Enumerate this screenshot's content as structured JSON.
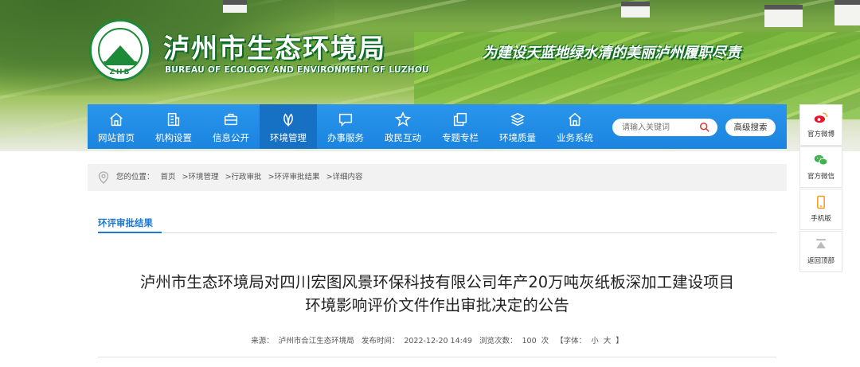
{
  "header": {
    "title": "泸州市生态环境局",
    "subtitle": "BUREAU OF ECOLOGY AND ENVIRONMENT OF LUZHOU",
    "slogan": "为建设天蓝地绿水清的美丽泸州履职尽责",
    "logo_text": "ZHB"
  },
  "nav": {
    "items": [
      {
        "label": "网站首页",
        "icon": "home-icon"
      },
      {
        "label": "机构设置",
        "icon": "building-icon"
      },
      {
        "label": "信息公开",
        "icon": "briefcase-icon"
      },
      {
        "label": "环境管理",
        "icon": "leaf-icon"
      },
      {
        "label": "办事服务",
        "icon": "message-icon"
      },
      {
        "label": "政民互动",
        "icon": "star-icon"
      },
      {
        "label": "专题专栏",
        "icon": "copy-icon"
      },
      {
        "label": "环境质量",
        "icon": "layers-icon"
      },
      {
        "label": "业务系统",
        "icon": "home-icon"
      }
    ],
    "active_index": 3,
    "search_placeholder": "请输入关键词",
    "advanced_search": "高级搜索"
  },
  "sidebar": {
    "items": [
      {
        "label": "官方微博",
        "icon": "weibo-icon"
      },
      {
        "label": "官方微信",
        "icon": "wechat-icon"
      },
      {
        "label": "手机版",
        "icon": "mobile-icon"
      },
      {
        "label": "返回顶部",
        "icon": "back-to-top-icon"
      }
    ]
  },
  "breadcrumb": {
    "prefix": "您的位置：",
    "items": [
      "首页",
      ">环境管理",
      ">行政审批",
      ">环评审批结果",
      ">详细内容"
    ]
  },
  "section": {
    "tab": "环评审批结果"
  },
  "article": {
    "title_line1": "泸州市生态环境局对四川宏图风景环保科技有限公司年产20万吨灰纸板深加工建设项目",
    "title_line2": "环境影响评价文件作出审批决定的公告",
    "source_label": "来源：",
    "source": "泸州市合江生态环境局",
    "publish_label": "发布时间：",
    "publish_time": "2022-12-20 14:49",
    "views_label": "浏览次数：",
    "views": "100",
    "views_unit": "次",
    "font_label": "【字体：",
    "font_small": "小",
    "font_large": "大",
    "font_end": "】"
  },
  "colors": {
    "nav_bg": "#1e8be4",
    "nav_active": "#1670c4",
    "accent": "#1a78d6",
    "brand_green": "#1d8a3a"
  }
}
